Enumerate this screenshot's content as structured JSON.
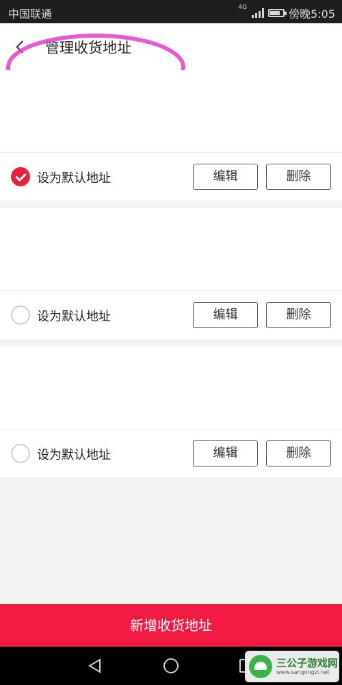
{
  "status_bar": {
    "carrier": "中国联通",
    "network": "4G",
    "time": "傍晚5:05"
  },
  "header": {
    "title": "管理收货地址",
    "highlight_color": "#e040c8"
  },
  "addresses": [
    {
      "default_label": "设为默认地址",
      "is_default": true,
      "edit_label": "编辑",
      "delete_label": "删除"
    },
    {
      "default_label": "设为默认地址",
      "is_default": false,
      "edit_label": "编辑",
      "delete_label": "删除"
    },
    {
      "default_label": "设为默认地址",
      "is_default": false,
      "edit_label": "编辑",
      "delete_label": "删除"
    }
  ],
  "add_address_label": "新增收货地址",
  "accent_color": "#f21b43",
  "watermark": {
    "title": "三公子游戏网",
    "url": "www.sangongzi.net"
  }
}
